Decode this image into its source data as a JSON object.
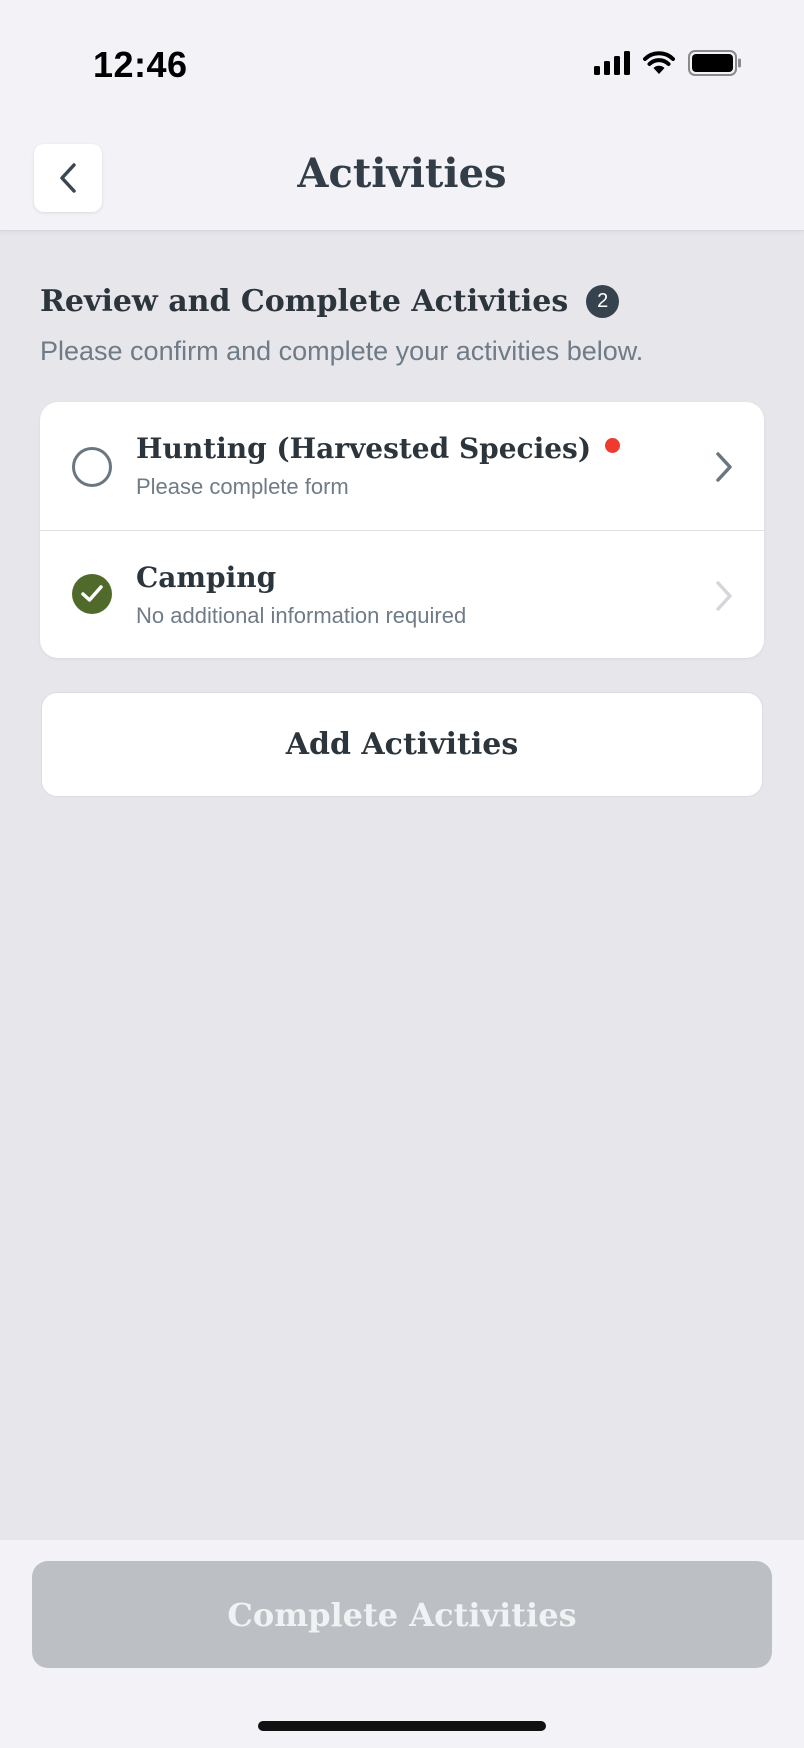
{
  "status_bar": {
    "time": "12:46",
    "icons": [
      "signal-icon",
      "wifi-icon",
      "battery-icon"
    ]
  },
  "nav": {
    "title": "Activities",
    "back_icon": "chevron-left-icon"
  },
  "section": {
    "title": "Review and Complete Activities",
    "count": "2",
    "subtitle": "Please confirm and complete your activities below."
  },
  "activities": [
    {
      "title": "Hunting (Harvested Species)",
      "subtitle": "Please complete form",
      "status": "incomplete",
      "required_indicator": true
    },
    {
      "title": "Camping",
      "subtitle": "No additional information required",
      "status": "complete",
      "required_indicator": false
    }
  ],
  "buttons": {
    "add_activities": "Add Activities",
    "complete_activities": "Complete Activities"
  },
  "colors": {
    "complete_green": "#4f6a2a",
    "required_red": "#ef3a2d",
    "disabled_button": "#bcbfc4",
    "badge": "#36424d"
  }
}
